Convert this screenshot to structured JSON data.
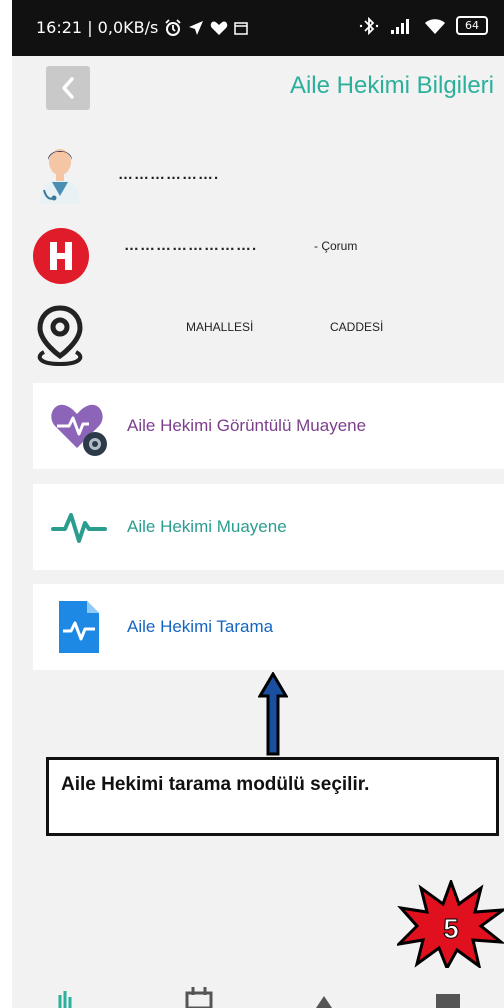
{
  "status_bar": {
    "time_speed": "16:21 | 0,0KB/s",
    "battery": "64"
  },
  "header": {
    "title": "Aile Hekimi Bilgileri"
  },
  "doctor": {
    "name_masked": "………………."
  },
  "hospital": {
    "name_masked": "…………………….",
    "city": "- Çorum"
  },
  "address": {
    "neighborhood": "MAHALLESİ",
    "street": "CADDESİ"
  },
  "menu": {
    "items": [
      {
        "label": "Aile Hekimi Görüntülü Muayene",
        "color": "#7b3f8c"
      },
      {
        "label": "Aile Hekimi Muayene",
        "color": "#2a9d8f"
      },
      {
        "label": "Aile Hekimi Tarama",
        "color": "#1565c0"
      }
    ]
  },
  "annotation": {
    "callout_text": "Aile Hekimi tarama modülü seçilir.",
    "step_number": "5"
  },
  "colors": {
    "accent": "#2bb09c",
    "hospital_red": "#e01c2a",
    "status_bar": "#111111"
  }
}
